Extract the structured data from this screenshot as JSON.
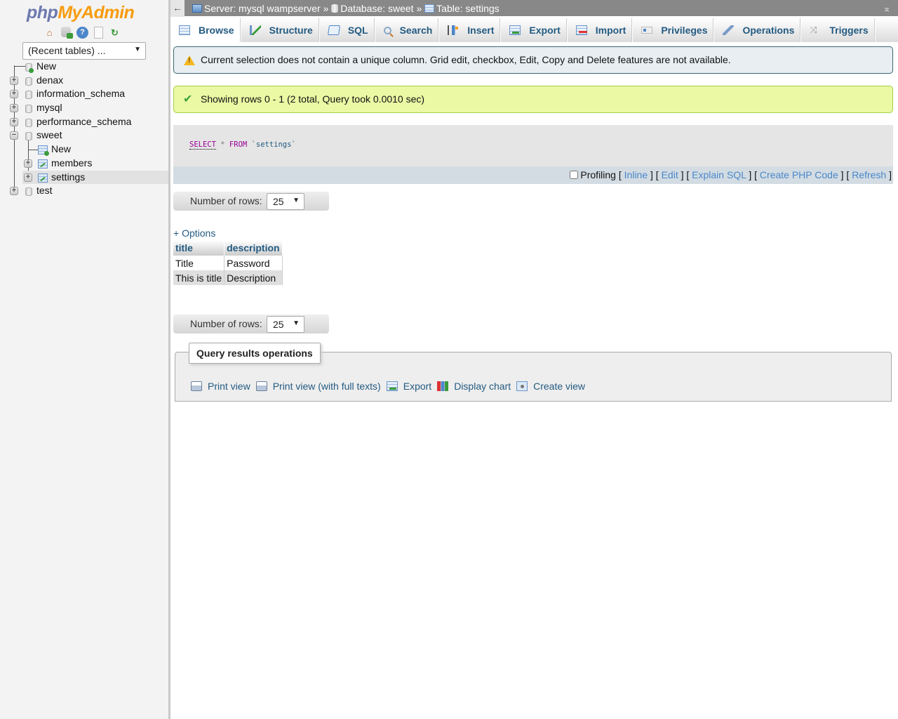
{
  "navigation": {
    "logo": {
      "php": "php",
      "myadmin": "MyAdmin"
    },
    "icons": [
      "home-icon",
      "logout-icon",
      "help-icon",
      "docs-icon",
      "reload-icon"
    ],
    "recent_tables": "(Recent tables) ...",
    "tree": [
      {
        "label": "New",
        "type": "new-db"
      },
      {
        "label": "denax",
        "type": "db"
      },
      {
        "label": "information_schema",
        "type": "db"
      },
      {
        "label": "mysql",
        "type": "db"
      },
      {
        "label": "performance_schema",
        "type": "db"
      },
      {
        "label": "sweet",
        "type": "db",
        "expanded": true
      },
      {
        "label": "New",
        "type": "new-table"
      },
      {
        "label": "members",
        "type": "table"
      },
      {
        "label": "settings",
        "type": "table",
        "selected": true
      },
      {
        "label": "test",
        "type": "db"
      }
    ]
  },
  "breadcrumb": {
    "server": "Server: mysql wampserver",
    "database": "Database: sweet",
    "table": "Table: settings",
    "separator": "»"
  },
  "tabs": [
    {
      "label": "Browse",
      "active": true
    },
    {
      "label": "Structure"
    },
    {
      "label": "SQL"
    },
    {
      "label": "Search"
    },
    {
      "label": "Insert"
    },
    {
      "label": "Export"
    },
    {
      "label": "Import"
    },
    {
      "label": "Privileges"
    },
    {
      "label": "Operations"
    },
    {
      "label": "Triggers"
    }
  ],
  "notice": "Current selection does not contain a unique column. Grid edit, checkbox, Edit, Copy and Delete features are not available.",
  "success": "Showing rows 0 - 1 (2 total, Query took 0.0010 sec)",
  "sql": {
    "select": "SELECT",
    "star": "*",
    "from": "FROM",
    "table": "`settings`",
    "profiling": "Profiling",
    "links": {
      "inline": "Inline",
      "edit": "Edit",
      "explain": "Explain SQL",
      "php": "Create PHP Code",
      "refresh": "Refresh"
    }
  },
  "rows_nav": {
    "label": "Number of rows:",
    "value": "25"
  },
  "options_link": "+ Options",
  "results": {
    "columns": [
      "title",
      "description"
    ],
    "rows": [
      [
        "Title",
        "Password"
      ],
      [
        "This is title",
        "Description"
      ]
    ]
  },
  "query_ops": {
    "legend": "Query results operations",
    "links": {
      "print": "Print view",
      "print_full": "Print view (with full texts)",
      "export": "Export",
      "chart": "Display chart",
      "view": "Create view"
    }
  }
}
